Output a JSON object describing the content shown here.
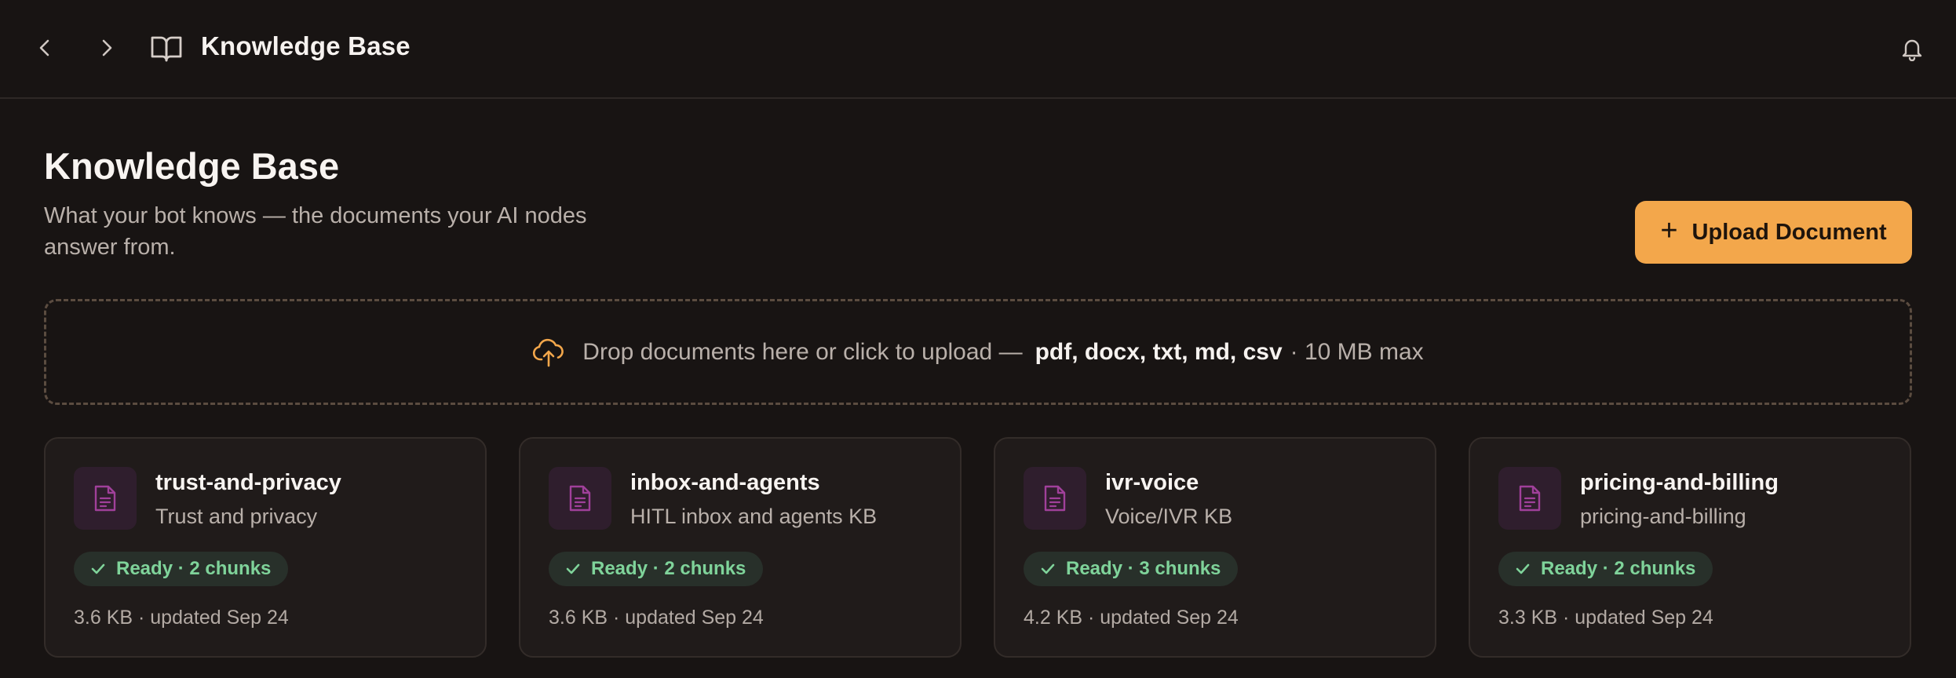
{
  "topbar": {
    "title": "Knowledge Base",
    "icons": {
      "back": "chevron-left-icon",
      "forward": "chevron-right-icon",
      "section": "book-icon",
      "notifications": "bell-icon"
    }
  },
  "header": {
    "title": "Knowledge Base",
    "subtitle": "What your bot knows — the documents your AI nodes answer from.",
    "upload_button": {
      "icon": "+",
      "label": "Upload Document"
    }
  },
  "dropzone": {
    "icon": "cloud-upload-icon",
    "text_before": "Drop documents here or click to upload —",
    "formats": "pdf, docx, txt, md, csv",
    "text_after": "· 10 MB max"
  },
  "documents": [
    {
      "name": "trust-and-privacy",
      "description": "Trust and privacy",
      "status": "Ready · 2 chunks",
      "meta": "3.6 KB · updated Sep 24"
    },
    {
      "name": "inbox-and-agents",
      "description": "HITL inbox and agents KB",
      "status": "Ready · 2 chunks",
      "meta": "3.6 KB · updated Sep 24"
    },
    {
      "name": "ivr-voice",
      "description": "Voice/IVR KB",
      "status": "Ready · 3 chunks",
      "meta": "4.2 KB · updated Sep 24"
    },
    {
      "name": "pricing-and-billing",
      "description": "pricing-and-billing",
      "status": "Ready · 2 chunks",
      "meta": "3.3 KB · updated Sep 24"
    }
  ],
  "colors": {
    "background": "#181413",
    "accent": "#f3a74b",
    "doc_icon": "#a0409a",
    "ready": "#7fd39a"
  }
}
